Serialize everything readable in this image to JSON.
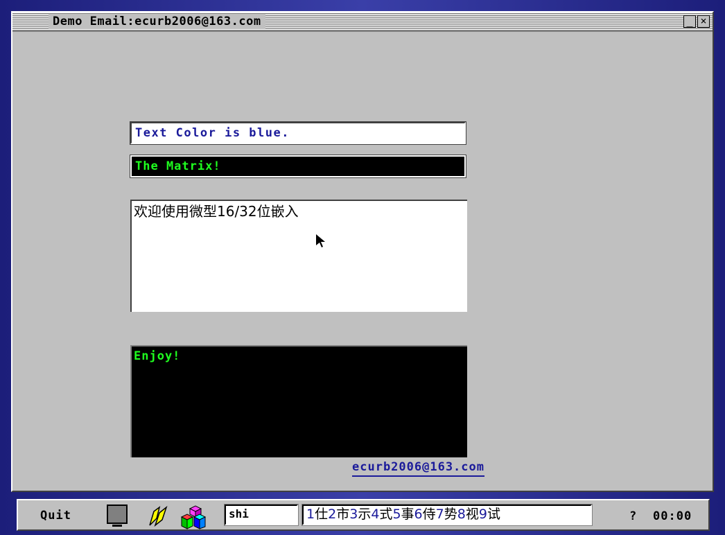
{
  "window": {
    "title": "Demo Email:ecurb2006@163.com",
    "minimize_glyph": "_",
    "close_glyph": "×"
  },
  "fields": {
    "blue_text": "Text Color is blue.",
    "matrix_text": "The Matrix!",
    "chinese_text": "欢迎使用微型16/32位嵌入",
    "enjoy_text": "Enjoy!"
  },
  "email_link": "ecurb2006@163.com",
  "taskbar": {
    "quit_label": "Quit",
    "ime_input_value": "shi",
    "candidates": [
      {
        "num": "1",
        "char": "仕"
      },
      {
        "num": "2",
        "char": "市"
      },
      {
        "num": "3",
        "char": "示"
      },
      {
        "num": "4",
        "char": "式"
      },
      {
        "num": "5",
        "char": "事"
      },
      {
        "num": "6",
        "char": "侍"
      },
      {
        "num": "7",
        "char": "势"
      },
      {
        "num": "8",
        "char": "视"
      },
      {
        "num": "9",
        "char": "试"
      }
    ],
    "help_label": "?",
    "clock": "00:00"
  },
  "colors": {
    "desktop": "#2a2f8a",
    "window_bg": "#c0c0c0",
    "blue_text": "#1a1a9a",
    "matrix_green": "#1fff1f"
  },
  "icons": [
    "monitor-icon",
    "tools-icon",
    "cubes-icon",
    "mouse-pointer-icon"
  ]
}
